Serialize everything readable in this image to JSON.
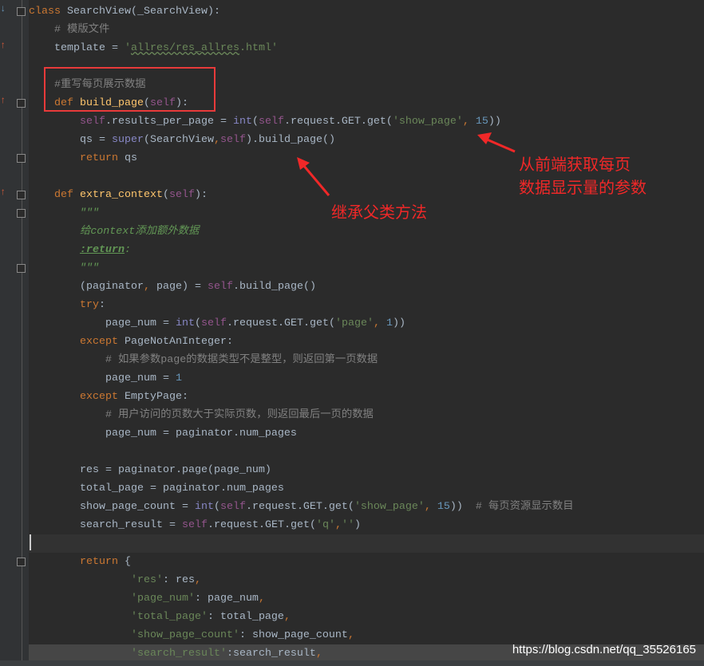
{
  "colors": {
    "background": "#2b2b2b",
    "keyword": "#cc7832",
    "string": "#6a8759",
    "self": "#94558d",
    "builtin": "#8888c6",
    "comment": "#808080",
    "function": "#ffc66d",
    "number": "#6897bb",
    "annotation": "#f02828"
  },
  "lines": [
    [
      [
        "kw",
        "class "
      ],
      [
        "",
        "SearchView(_SearchView):"
      ]
    ],
    [
      [
        "cm",
        "    # 模版文件"
      ]
    ],
    [
      [
        "",
        "    template = "
      ],
      [
        "str",
        "'"
      ],
      [
        "str sq",
        "allres/res_allres"
      ],
      [
        "str",
        ".html'"
      ]
    ],
    [],
    [
      [
        "cm",
        "    #重写每页展示数据"
      ]
    ],
    [
      [
        "kw",
        "    def "
      ],
      [
        "fn",
        "build_page"
      ],
      [
        "",
        "("
      ],
      [
        "self",
        "self"
      ],
      [
        "",
        "):"
      ]
    ],
    [
      [
        "self",
        "        self"
      ],
      [
        "",
        ".results_per_page = "
      ],
      [
        "bi",
        "int"
      ],
      [
        "",
        "("
      ],
      [
        "self",
        "self"
      ],
      [
        "",
        ".request.GET.get("
      ],
      [
        "str",
        "'show_page'"
      ],
      [
        "kw",
        ", "
      ],
      [
        "num",
        "15"
      ],
      [
        "",
        "))"
      ]
    ],
    [
      [
        "",
        "        qs = "
      ],
      [
        "bi",
        "super"
      ],
      [
        "",
        "(SearchView"
      ],
      [
        "kw",
        ","
      ],
      [
        "self",
        "self"
      ],
      [
        "",
        ").build_page()"
      ]
    ],
    [
      [
        "kw",
        "        return "
      ],
      [
        "",
        "qs"
      ]
    ],
    [],
    [
      [
        "kw",
        "    def "
      ],
      [
        "fn",
        "extra_context"
      ],
      [
        "",
        "("
      ],
      [
        "self",
        "self"
      ],
      [
        "",
        "):"
      ]
    ],
    [
      [
        "doc",
        "        \"\"\""
      ]
    ],
    [
      [
        "doc",
        "        给context添加额外数据"
      ]
    ],
    [
      [
        "",
        "        "
      ],
      [
        "docb",
        ":return"
      ],
      [
        "doc",
        ":"
      ]
    ],
    [
      [
        "doc",
        "        \"\"\""
      ]
    ],
    [
      [
        "",
        "        (paginator"
      ],
      [
        "kw",
        ", "
      ],
      [
        "",
        "page) = "
      ],
      [
        "self",
        "self"
      ],
      [
        "",
        ".build_page()"
      ]
    ],
    [
      [
        "kw",
        "        try"
      ],
      [
        "",
        ":"
      ]
    ],
    [
      [
        "",
        "            page_num = "
      ],
      [
        "bi",
        "int"
      ],
      [
        "",
        "("
      ],
      [
        "self",
        "self"
      ],
      [
        "",
        ".request.GET.get("
      ],
      [
        "str",
        "'page'"
      ],
      [
        "kw",
        ", "
      ],
      [
        "num",
        "1"
      ],
      [
        "",
        "))"
      ]
    ],
    [
      [
        "kw",
        "        except "
      ],
      [
        "",
        "PageNotAnInteger:"
      ]
    ],
    [
      [
        "cm",
        "            # 如果参数page的数据类型不是整型，则返回第一页数据"
      ]
    ],
    [
      [
        "",
        "            page_num = "
      ],
      [
        "num",
        "1"
      ]
    ],
    [
      [
        "kw",
        "        except "
      ],
      [
        "",
        "EmptyPage:"
      ]
    ],
    [
      [
        "cm",
        "            # 用户访问的页数大于实际页数，则返回最后一页的数据"
      ]
    ],
    [
      [
        "",
        "            page_num = paginator.num_pages"
      ]
    ],
    [],
    [
      [
        "",
        "        res = paginator.page(page_num)"
      ]
    ],
    [
      [
        "",
        "        total_page = paginator.num_pages"
      ]
    ],
    [
      [
        "",
        "        show_page_count = "
      ],
      [
        "bi",
        "int"
      ],
      [
        "",
        "("
      ],
      [
        "self",
        "self"
      ],
      [
        "",
        ".request.GET.get("
      ],
      [
        "str",
        "'show_page'"
      ],
      [
        "kw",
        ", "
      ],
      [
        "num",
        "15"
      ],
      [
        "",
        "))  "
      ],
      [
        "cm",
        "# 每页资源显示数目"
      ]
    ],
    [
      [
        "",
        "        search_result = "
      ],
      [
        "self",
        "self"
      ],
      [
        "",
        ".request.GET.get("
      ],
      [
        "str",
        "'q'"
      ],
      [
        "kw",
        ","
      ],
      [
        "str",
        "''"
      ],
      [
        "",
        ")"
      ]
    ],
    [],
    [
      [
        "kw",
        "        return "
      ],
      [
        "",
        "{"
      ]
    ],
    [
      [
        "str",
        "                'res'"
      ],
      [
        "",
        ": res"
      ],
      [
        "kw",
        ","
      ]
    ],
    [
      [
        "str",
        "                'page_num'"
      ],
      [
        "",
        ": page_num"
      ],
      [
        "kw",
        ","
      ]
    ],
    [
      [
        "str",
        "                'total_page'"
      ],
      [
        "",
        ": total_page"
      ],
      [
        "kw",
        ","
      ]
    ],
    [
      [
        "str",
        "                'show_page_count'"
      ],
      [
        "",
        ": show_page_count"
      ],
      [
        "kw",
        ","
      ]
    ],
    [
      [
        "str",
        "                'search_result'"
      ],
      [
        "",
        ":search_result"
      ],
      [
        "kw",
        ","
      ]
    ]
  ],
  "annotations": {
    "frontend_param_1": "从前端获取每页",
    "frontend_param_2": "数据显示量的参数",
    "inherit": "继承父类方法"
  },
  "watermark": "https://blog.csdn.net/qq_35526165"
}
